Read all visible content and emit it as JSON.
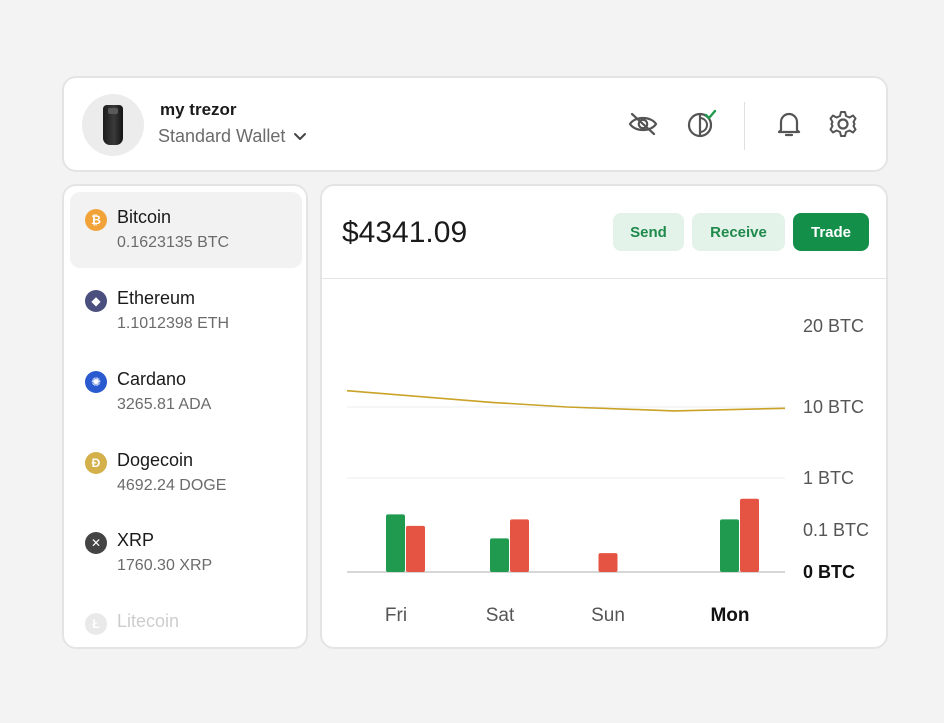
{
  "header": {
    "wallet_name": "my trezor",
    "wallet_type": "Standard Wallet",
    "icons": [
      "device-icon",
      "eye-off-icon",
      "tor-icon",
      "bell-icon",
      "gear-icon",
      "chevron-down-icon"
    ]
  },
  "sidebar": {
    "items": [
      {
        "name": "Bitcoin",
        "amount": "0.1623135 BTC",
        "icon": "bitcoin-icon",
        "symbol": "₿",
        "color": "#f1a33a"
      },
      {
        "name": "Ethereum",
        "amount": "1.1012398 ETH",
        "icon": "ethereum-icon",
        "symbol": "◆",
        "color": "#4a4f7d"
      },
      {
        "name": "Cardano",
        "amount": "3265.81 ADA",
        "icon": "cardano-icon",
        "symbol": "✺",
        "color": "#2a5ad0"
      },
      {
        "name": "Dogecoin",
        "amount": "4692.24 DOGE",
        "icon": "dogecoin-icon",
        "symbol": "Ð",
        "color": "#d4b04a"
      },
      {
        "name": "XRP",
        "amount": "1760.30 XRP",
        "icon": "xrp-icon",
        "symbol": "✕",
        "color": "#444444"
      },
      {
        "name": "Litecoin",
        "amount": "",
        "icon": "litecoin-icon",
        "symbol": "Ł",
        "color": "#9e9e9e"
      }
    ]
  },
  "main": {
    "balance": "$4341.09",
    "buttons": {
      "send": "Send",
      "receive": "Receive",
      "trade": "Trade"
    }
  },
  "colors": {
    "accent": "#138f4a",
    "accent_light": "#e3f3e9",
    "bar_green": "#1f9a4f",
    "bar_red": "#e55442",
    "line": "#c9a227"
  },
  "chart_data": {
    "type": "bar",
    "categories": [
      "Fri",
      "Sat",
      "Sun",
      "Mon"
    ],
    "highlight_category": "Mon",
    "y_ticks": [
      "20 BTC",
      "10 BTC",
      "1 BTC",
      "0.1 BTC",
      "0 BTC"
    ],
    "series": [
      {
        "color": "green",
        "values": [
          0.2,
          0.08,
          null,
          0.16
        ]
      },
      {
        "color": "red",
        "values": [
          0.12,
          0.16,
          0.045,
          0.4
        ]
      }
    ],
    "line": {
      "values": [
        11.5,
        10.4,
        8.8,
        9.6
      ],
      "scale": "log"
    },
    "grid": true
  }
}
